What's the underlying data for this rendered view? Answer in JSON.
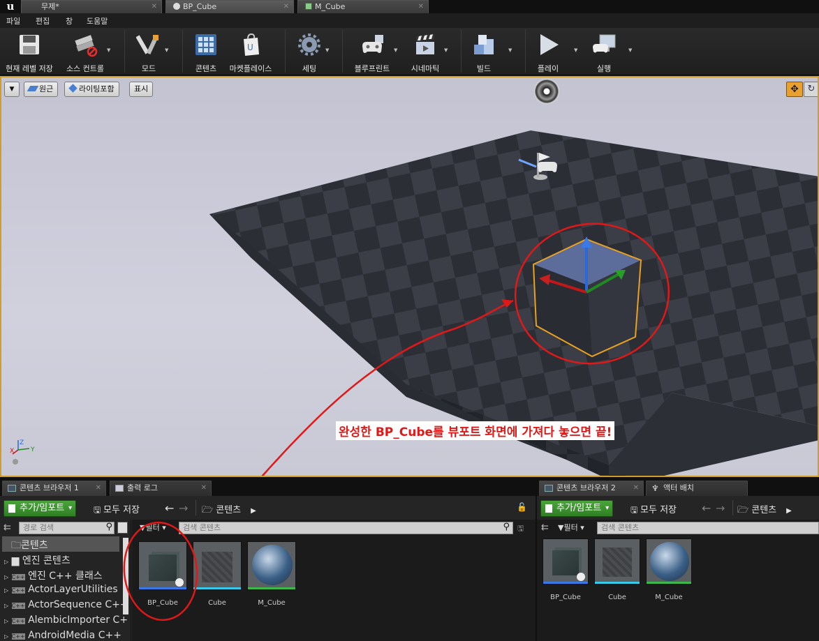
{
  "app": {
    "logo_text": "u"
  },
  "tabs": [
    {
      "label": "무제*"
    },
    {
      "label": "BP_Cube"
    },
    {
      "label": "M_Cube"
    }
  ],
  "menu": [
    "파일",
    "편집",
    "창",
    "도움말"
  ],
  "toolbar": [
    {
      "label": "현재 레벨 저장",
      "icon": "floppy-disk-icon"
    },
    {
      "label": "소스 컨트롤",
      "icon": "source-control-icon"
    },
    {
      "label": "모드",
      "icon": "modes-icon"
    },
    {
      "label": "콘텐츠",
      "icon": "content-grid-icon"
    },
    {
      "label": "마켓플레이스",
      "icon": "marketplace-bag-icon"
    },
    {
      "label": "세팅",
      "icon": "gear-icon"
    },
    {
      "label": "블루프린트",
      "icon": "gamepad-icon"
    },
    {
      "label": "시네마틱",
      "icon": "clapperboard-icon"
    },
    {
      "label": "빌드",
      "icon": "build-blocks-icon"
    },
    {
      "label": "플레이",
      "icon": "play-icon"
    },
    {
      "label": "실행",
      "icon": "launch-monitor-icon"
    }
  ],
  "viewport": {
    "buttons": [
      "원근",
      "라이팅포함",
      "표시"
    ],
    "callout": "완성한 BP_Cube를 뷰포트 화면에 가져다 놓으면 끝!",
    "axis": {
      "x": "X",
      "y": "Y",
      "z": "Z"
    }
  },
  "colors": {
    "selection": "#d29c2a",
    "annotation": "#e01818",
    "green_button": "#3d9430"
  },
  "browser1": {
    "tabs": [
      "콘텐츠 브라우저 1",
      "출력 로그"
    ],
    "add_import": "추가/임포트",
    "save_all": "모두 저장",
    "path": "콘텐츠",
    "path_search_placeholder": "경로 검색",
    "filter": "필터",
    "asset_search_placeholder": "검색 콘텐츠",
    "tree": [
      "콘텐츠",
      "엔진 콘텐츠",
      "엔진 C++ 클래스",
      "ActorLayerUtilities",
      "ActorSequence C++",
      "AlembicImporter C+",
      "AndroidMedia C++"
    ],
    "assets": [
      "BP_Cube",
      "Cube",
      "M_Cube"
    ]
  },
  "browser2": {
    "tabs": [
      "콘텐츠 브라우저 2",
      "액터 배치"
    ],
    "add_import": "추가/임포트",
    "save_all": "모두 저장",
    "path": "콘텐츠",
    "filter": "필터",
    "asset_search_placeholder": "검색 콘텐츠",
    "assets": [
      "BP_Cube",
      "Cube",
      "M_Cube"
    ]
  }
}
